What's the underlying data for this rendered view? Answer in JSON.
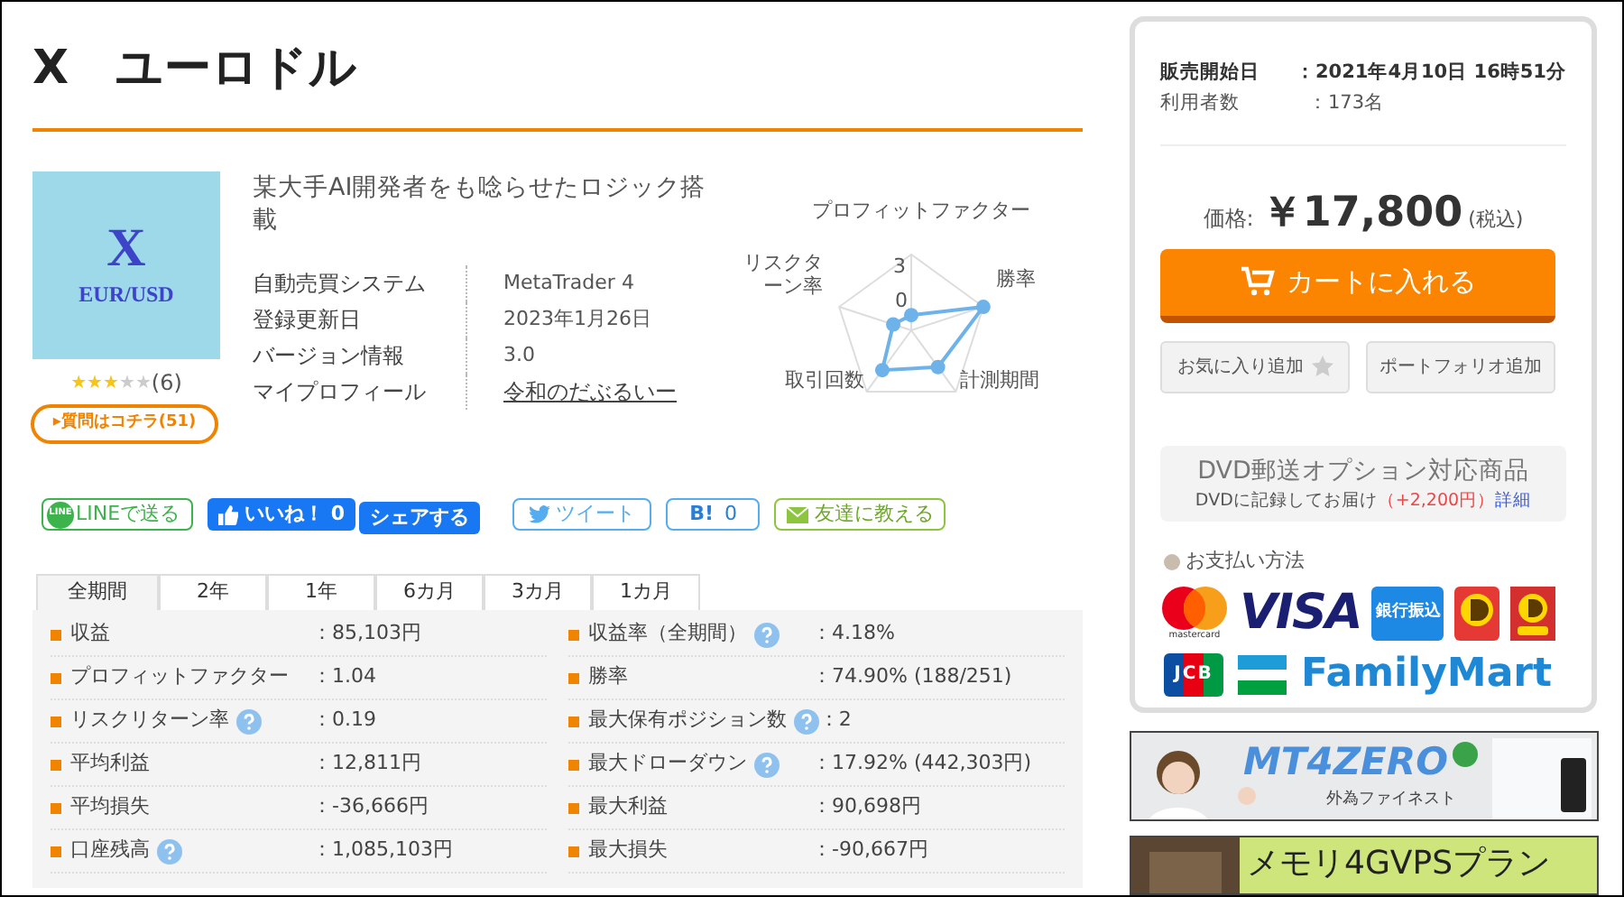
{
  "title": "X　ユーロドル",
  "product": {
    "image": {
      "symbol": "X",
      "pair": "EUR/USD"
    },
    "stars": 3,
    "review_count": "(6)",
    "question_button": "▸質問はコチラ(51)",
    "headline": "某大手AI開発者をも唸らせたロジック搭載",
    "info": [
      {
        "label": "自動売買システム",
        "value": "MetaTrader 4",
        "kind": "text"
      },
      {
        "label": "登録更新日",
        "value": "2023年1月26日",
        "kind": "text"
      },
      {
        "label": "バージョン情報",
        "value": "3.0",
        "kind": "text"
      },
      {
        "label": "マイプロフィール",
        "value": "令和のだぶるいー",
        "kind": "link"
      }
    ]
  },
  "radar": {
    "labels": [
      "プロフィットファクター",
      "リスクターン率",
      "勝率",
      "取引回数",
      "計測期間"
    ],
    "ticks": [
      "3",
      "0"
    ]
  },
  "share_buttons": [
    {
      "kind": "line",
      "label": "LINEで送る",
      "icon_text": "LINE"
    },
    {
      "kind": "like",
      "label": "いいね！",
      "count": "0"
    },
    {
      "kind": "share",
      "label": "シェアする"
    },
    {
      "kind": "tweet",
      "label": "ツイート"
    },
    {
      "kind": "hatena",
      "label": "B!",
      "count": "0"
    },
    {
      "kind": "mail",
      "label": "友達に教える"
    }
  ],
  "tabs": [
    {
      "label": "全期間",
      "selected": true
    },
    {
      "label": "2年",
      "selected": false
    },
    {
      "label": "1年",
      "selected": false
    },
    {
      "label": "6カ月",
      "selected": false
    },
    {
      "label": "3カ月",
      "selected": false
    },
    {
      "label": "1カ月",
      "selected": false
    }
  ],
  "stats": [
    {
      "label": "収益",
      "help": false,
      "value": "：85,103円"
    },
    {
      "label": "収益率（全期間）",
      "help": true,
      "value": "：4.18%"
    },
    {
      "label": "プロフィットファクター",
      "help": false,
      "value": "：1.04"
    },
    {
      "label": "勝率",
      "help": false,
      "value": "：74.90% (188/251)"
    },
    {
      "label": "リスクリターン率",
      "help": true,
      "value": "：0.19"
    },
    {
      "label": "最大保有ポジション数",
      "help": true,
      "value": "：2"
    },
    {
      "label": "平均利益",
      "help": false,
      "value": "：12,811円"
    },
    {
      "label": "最大ドローダウン",
      "help": true,
      "value": "：17.92% (442,303円)"
    },
    {
      "label": "平均損失",
      "help": false,
      "value": "：-36,666円"
    },
    {
      "label": "最大利益",
      "help": false,
      "value": "：90,698円"
    },
    {
      "label": "口座残高",
      "help": true,
      "value": "：1,085,103円"
    },
    {
      "label": "最大損失",
      "help": false,
      "value": "：-90,667円"
    }
  ],
  "sidebar": {
    "details": [
      {
        "label": "販売開始日",
        "value": "：2021年4月10日 16時51分",
        "emphasis": true
      },
      {
        "label": "利用者数",
        "value": "：173名",
        "emphasis": false
      }
    ],
    "price": {
      "label": "価格:",
      "amount": "￥17,800",
      "tax": "(税込)"
    },
    "cart_button": "カートに入れる",
    "buttons": [
      {
        "label": "お気に入り追加",
        "kind": "favorite"
      },
      {
        "label": "ポートフォリオ追加",
        "kind": "plain"
      }
    ],
    "dvd": {
      "title": "DVD郵送オプション対応商品",
      "text": "DVDに記録してお届け",
      "fee": "（+2,200円）",
      "link": "詳細"
    },
    "payment": {
      "title": "お支払い方法",
      "methods": [
        {
          "kind": "mastercard",
          "label": "mastercard"
        },
        {
          "kind": "visa",
          "label": "VISA"
        },
        {
          "kind": "bank",
          "label": "銀行振込"
        },
        {
          "kind": "d"
        },
        {
          "kind": "daily"
        },
        {
          "kind": "jcb",
          "label": "JCB"
        },
        {
          "kind": "familymart",
          "label": "FamilyMart"
        }
      ]
    }
  },
  "banners": [
    {
      "title": "MT4ZERO",
      "subtitle": "外為ファイネスト"
    },
    {
      "title": "メモリ4GVPSプラン"
    }
  ]
}
